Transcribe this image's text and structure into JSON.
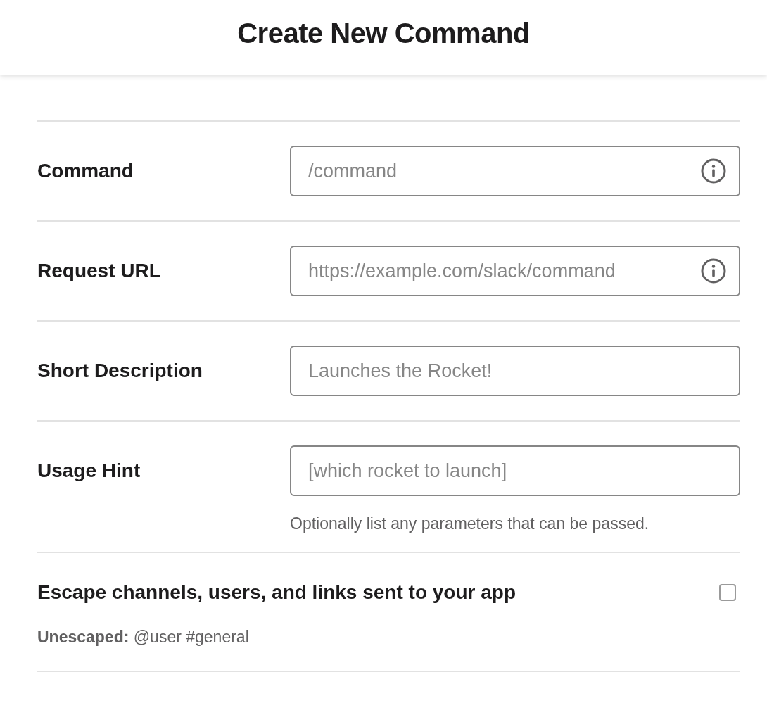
{
  "header": {
    "title": "Create New Command"
  },
  "fields": [
    {
      "label": "Command",
      "placeholder": "/command",
      "info": true
    },
    {
      "label": "Request URL",
      "placeholder": "https://example.com/slack/command",
      "info": true
    },
    {
      "label": "Short Description",
      "placeholder": "Launches the Rocket!",
      "info": false
    },
    {
      "label": "Usage Hint",
      "placeholder": "[which rocket to launch]",
      "info": false,
      "hint": "Optionally list any parameters that can be passed."
    }
  ],
  "escape_option": {
    "label": "Escape channels, users, and links sent to your app",
    "checked": false,
    "note": "**Unescaped:** @user #general"
  }
}
